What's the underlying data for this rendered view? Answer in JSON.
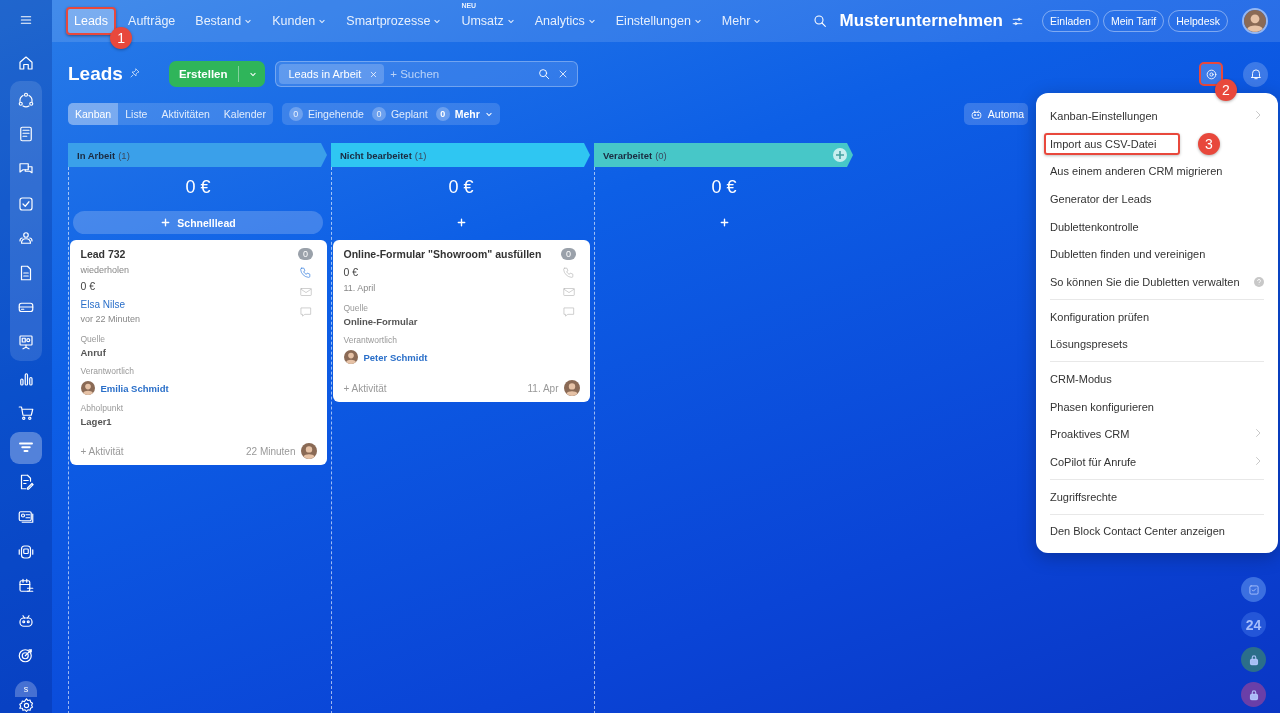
{
  "sidebar": {
    "top": [
      {
        "kind": "home",
        "selected": false
      }
    ],
    "group": [
      {
        "kind": "cycle",
        "selected": false
      },
      {
        "kind": "news",
        "selected": false
      },
      {
        "kind": "chat",
        "selected": false
      },
      {
        "kind": "task",
        "selected": false
      },
      {
        "kind": "people",
        "selected": false
      },
      {
        "kind": "doc",
        "selected": false
      },
      {
        "kind": "card",
        "selected": false
      },
      {
        "kind": "board",
        "selected": false
      }
    ],
    "items": [
      {
        "kind": "chart",
        "selected": false
      },
      {
        "kind": "cart",
        "selected": false
      },
      {
        "kind": "filter",
        "selected": true
      },
      {
        "kind": "docedit",
        "selected": false
      },
      {
        "kind": "idcard",
        "selected": false
      },
      {
        "kind": "device",
        "selected": false
      },
      {
        "kind": "calendar",
        "selected": false
      },
      {
        "kind": "robot",
        "selected": false
      },
      {
        "kind": "target",
        "selected": false
      }
    ],
    "user_initial": "s"
  },
  "nav": {
    "items": [
      {
        "label": "Leads",
        "selected": true,
        "dropdown": false,
        "callout": "1"
      },
      {
        "label": "Aufträge",
        "selected": false,
        "dropdown": false
      },
      {
        "label": "Bestand",
        "selected": false,
        "dropdown": true
      },
      {
        "label": "Kunden",
        "selected": false,
        "dropdown": true
      },
      {
        "label": "Smartprozesse",
        "selected": false,
        "dropdown": true
      },
      {
        "label": "Umsatz",
        "selected": false,
        "dropdown": true,
        "badge": "NEU"
      },
      {
        "label": "Analytics",
        "selected": false,
        "dropdown": true
      },
      {
        "label": "Einstellungen",
        "selected": false,
        "dropdown": true
      },
      {
        "label": "Mehr",
        "selected": false,
        "dropdown": true
      }
    ],
    "company": "Musterunternehmen",
    "buttons": [
      "Einladen",
      "Mein Tarif",
      "Helpdesk"
    ]
  },
  "toolbar": {
    "title": "Leads",
    "create_button": "Erstellen",
    "filter_chip": "Leads in Arbeit",
    "search_placeholder": "+ Suchen",
    "settings_callout": "2",
    "views": [
      {
        "label": "Kanban",
        "selected": true
      },
      {
        "label": "Liste",
        "selected": false
      },
      {
        "label": "Aktivitäten",
        "selected": false
      },
      {
        "label": "Kalender",
        "selected": false
      }
    ],
    "counters": [
      {
        "count": "0",
        "label": "Eingehende",
        "dropdown": false
      },
      {
        "count": "0",
        "label": "Geplant",
        "dropdown": false
      },
      {
        "count": "0",
        "label": "Mehr",
        "dropdown": true
      }
    ],
    "automation_button": "Automa"
  },
  "columns": [
    {
      "title": "In Arbeit",
      "count": "(1)",
      "color": "#3aa0ea",
      "total": "0 €",
      "add_label": "Schnelllead",
      "cards": [
        {
          "title": "Lead 732",
          "counter": "0",
          "phone_active": true,
          "lines": [
            {
              "kind": "muted",
              "text": "wiederholen"
            },
            {
              "kind": "amount",
              "text": "0 €"
            },
            {
              "kind": "link",
              "text": "Elsa Nilse"
            },
            {
              "kind": "muted",
              "text": "vor 22 Minuten"
            },
            {
              "kind": "label",
              "text": "Quelle"
            },
            {
              "kind": "value",
              "text": "Anruf"
            },
            {
              "kind": "label",
              "text": "Verantwortlich"
            },
            {
              "kind": "person",
              "text": "Emilia Schmidt"
            },
            {
              "kind": "label",
              "text": "Abholpunkt"
            },
            {
              "kind": "value",
              "text": "Lager1"
            }
          ],
          "activity": "+ Aktivität",
          "time": "22 Minuten"
        }
      ]
    },
    {
      "title": "Nicht bearbeitet",
      "count": "(1)",
      "color": "#2fc6f2",
      "total": "0 €",
      "cards": [
        {
          "title": "Online-Formular \"Showroom\" ausfüllen",
          "counter": "0",
          "phone_active": false,
          "lines": [
            {
              "kind": "amount",
              "text": "0 €"
            },
            {
              "kind": "muted",
              "text": "11. April"
            },
            {
              "kind": "label",
              "text": "Quelle"
            },
            {
              "kind": "value",
              "text": "Online-Formular"
            },
            {
              "kind": "label",
              "text": "Verantwortlich"
            },
            {
              "kind": "person",
              "text": "Peter Schmidt"
            }
          ],
          "activity": "+ Aktivität",
          "time": "11. Apr"
        }
      ]
    },
    {
      "title": "Verarbeitet",
      "count": "(0)",
      "color": "#47c7c8",
      "total": "0 €"
    }
  ],
  "menu": {
    "groups": [
      [
        {
          "label": "Kanban-Einstellungen",
          "submenu": true,
          "help": false
        },
        {
          "label": "Import aus CSV-Datei",
          "submenu": false,
          "help": false,
          "callout": "3"
        },
        {
          "label": "Aus einem anderen CRM migrieren",
          "submenu": false,
          "help": false
        },
        {
          "label": "Generator der Leads",
          "submenu": false,
          "help": false
        },
        {
          "label": "Dublettenkontrolle",
          "submenu": false,
          "help": false
        },
        {
          "label": "Dubletten finden und vereinigen",
          "submenu": false,
          "help": false
        },
        {
          "label": "So können Sie die Dubletten verwalten",
          "submenu": false,
          "help": true
        }
      ],
      [
        {
          "label": "Konfiguration prüfen",
          "submenu": false,
          "help": false
        },
        {
          "label": "Lösungspresets",
          "submenu": false,
          "help": false
        }
      ],
      [
        {
          "label": "CRM-Modus",
          "submenu": false,
          "help": false
        },
        {
          "label": "Phasen konfigurieren",
          "submenu": false,
          "help": false
        },
        {
          "label": "Proaktives CRM",
          "submenu": true,
          "help": false
        },
        {
          "label": "CoPilot für Anrufe",
          "submenu": true,
          "help": false
        }
      ],
      [
        {
          "label": "Zugriffsrechte",
          "submenu": false,
          "help": false
        }
      ],
      [
        {
          "label": "Den Block Contact Center anzeigen",
          "submenu": false,
          "help": false
        }
      ]
    ]
  },
  "right_rail": [
    {
      "kind": "task",
      "color": "#3b6fe0"
    },
    {
      "kind": "text",
      "text": "24",
      "color": "#2456d8"
    },
    {
      "kind": "lock",
      "color": "#2b6e8a"
    },
    {
      "kind": "lock",
      "color": "#6a3fa8"
    }
  ]
}
